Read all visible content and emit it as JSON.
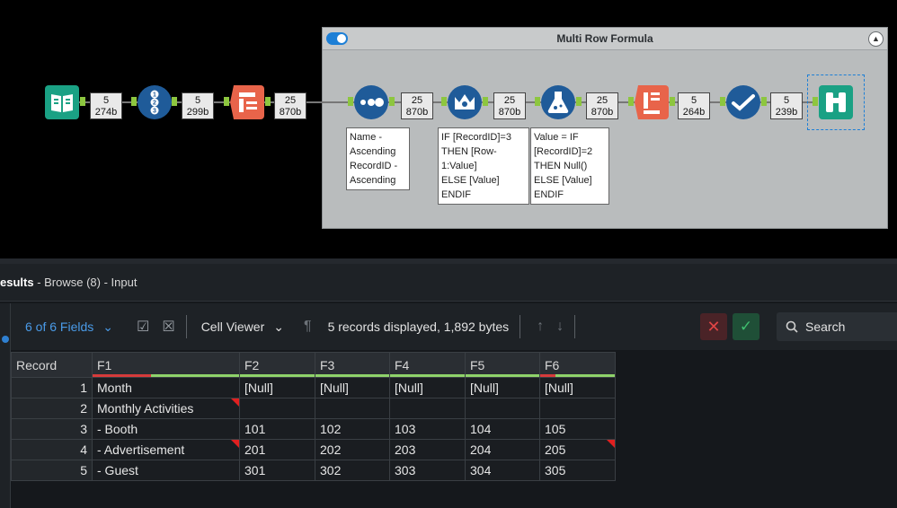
{
  "container": {
    "title": "Multi Row Formula"
  },
  "badges": [
    {
      "count": "5",
      "size": "274b"
    },
    {
      "count": "5",
      "size": "299b"
    },
    {
      "count": "25",
      "size": "870b"
    },
    {
      "count": "25",
      "size": "870b"
    },
    {
      "count": "25",
      "size": "870b"
    },
    {
      "count": "25",
      "size": "870b"
    },
    {
      "count": "5",
      "size": "264b"
    },
    {
      "count": "5",
      "size": "239b"
    }
  ],
  "annotations": {
    "sort": "Name -\nAscending\nRecordID -\nAscending",
    "multirow": "IF [RecordID]=3\nTHEN [Row-\n1:Value]\nELSE [Value]\nENDIF",
    "formula": "Value = IF\n[RecordID]=2\nTHEN Null()\nELSE [Value]\nENDIF"
  },
  "results": {
    "title_bold": "esults",
    "title_rest": " - Browse (8) - Input",
    "fields_label": "6 of 6 Fields",
    "cell_viewer": "Cell Viewer",
    "records_info": "5 records displayed, 1,892 bytes",
    "search_placeholder": "Search"
  },
  "table": {
    "headers": [
      "Record",
      "F1",
      "F2",
      "F3",
      "F4",
      "F5",
      "F6"
    ],
    "rows": [
      [
        "1",
        "Month",
        "[Null]",
        "[Null]",
        "[Null]",
        "[Null]",
        "[Null]"
      ],
      [
        "2",
        "Monthly Activities",
        "",
        "",
        "",
        "",
        ""
      ],
      [
        "3",
        "- Booth",
        "101",
        "102",
        "103",
        "104",
        "105"
      ],
      [
        "4",
        "- Advertisement",
        "201",
        "202",
        "203",
        "204",
        "205"
      ],
      [
        "5",
        "- Guest",
        "301",
        "302",
        "303",
        "304",
        "305"
      ]
    ]
  },
  "colors": {
    "accent": "#1d7fd6",
    "teal": "#1aa184",
    "orange": "#e8644a",
    "navy": "#1f5b99"
  }
}
